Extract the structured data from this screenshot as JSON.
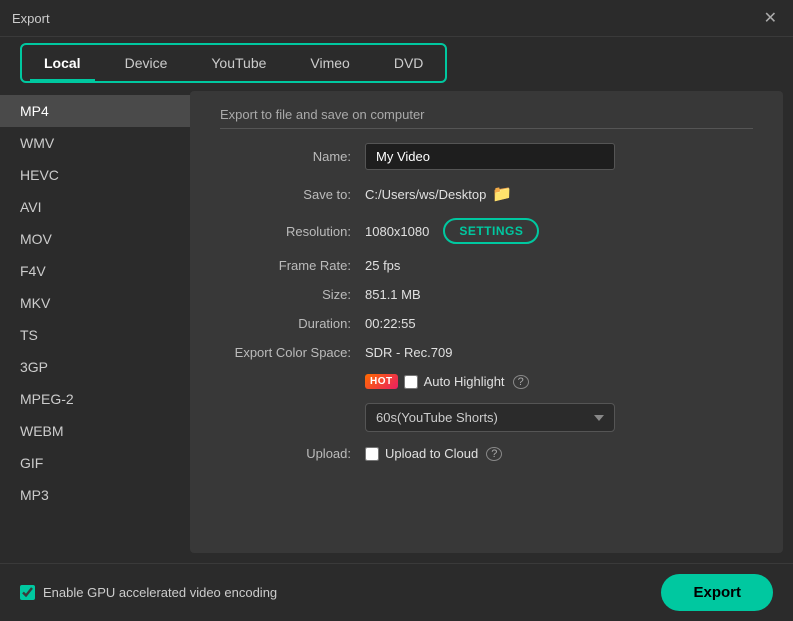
{
  "window": {
    "title": "Export",
    "close_label": "✕"
  },
  "tabs": [
    {
      "id": "local",
      "label": "Local",
      "active": true
    },
    {
      "id": "device",
      "label": "Device",
      "active": false
    },
    {
      "id": "youtube",
      "label": "YouTube",
      "active": false
    },
    {
      "id": "vimeo",
      "label": "Vimeo",
      "active": false
    },
    {
      "id": "dvd",
      "label": "DVD",
      "active": false
    }
  ],
  "sidebar": {
    "items": [
      {
        "id": "mp4",
        "label": "MP4",
        "active": true
      },
      {
        "id": "wmv",
        "label": "WMV",
        "active": false
      },
      {
        "id": "hevc",
        "label": "HEVC",
        "active": false
      },
      {
        "id": "avi",
        "label": "AVI",
        "active": false
      },
      {
        "id": "mov",
        "label": "MOV",
        "active": false
      },
      {
        "id": "f4v",
        "label": "F4V",
        "active": false
      },
      {
        "id": "mkv",
        "label": "MKV",
        "active": false
      },
      {
        "id": "ts",
        "label": "TS",
        "active": false
      },
      {
        "id": "3gp",
        "label": "3GP",
        "active": false
      },
      {
        "id": "mpeg2",
        "label": "MPEG-2",
        "active": false
      },
      {
        "id": "webm",
        "label": "WEBM",
        "active": false
      },
      {
        "id": "gif",
        "label": "GIF",
        "active": false
      },
      {
        "id": "mp3",
        "label": "MP3",
        "active": false
      }
    ]
  },
  "content": {
    "section_title": "Export to file and save on computer",
    "name_label": "Name:",
    "name_value": "My Video",
    "save_label": "Save to:",
    "save_path": "C:/Users/ws/Desktop",
    "folder_icon": "📁",
    "resolution_label": "Resolution:",
    "resolution_value": "1080x1080",
    "settings_btn": "SETTINGS",
    "frame_rate_label": "Frame Rate:",
    "frame_rate_value": "25 fps",
    "size_label": "Size:",
    "size_value": "851.1 MB",
    "duration_label": "Duration:",
    "duration_value": "00:22:55",
    "color_space_label": "Export Color Space:",
    "color_space_value": "SDR - Rec.709",
    "hot_badge": "HOT",
    "auto_highlight_label": "Auto Highlight",
    "help_icon": "?",
    "dropdown_options": [
      {
        "value": "60s",
        "label": "60s(YouTube Shorts)"
      }
    ],
    "upload_label": "Upload:",
    "upload_cloud_label": "Upload to Cloud"
  },
  "bottom": {
    "gpu_label": "Enable GPU accelerated video encoding",
    "export_label": "Export"
  }
}
